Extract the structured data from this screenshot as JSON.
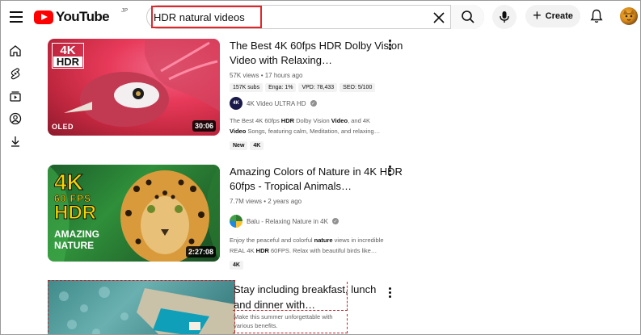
{
  "header": {
    "logo_text": "YouTube",
    "logo_country": "JP",
    "search_value": "HDR natural videos",
    "create_label": "Create"
  },
  "sidebar": {
    "items": [
      {
        "icon": "home-icon"
      },
      {
        "icon": "shorts-icon"
      },
      {
        "icon": "subscriptions-icon"
      },
      {
        "icon": "you-icon"
      },
      {
        "icon": "downloads-icon"
      }
    ]
  },
  "results": [
    {
      "thumb_badge_top": "4K",
      "thumb_badge_bottom": "HDR",
      "thumb_corner": "OLED",
      "duration": "30:06",
      "title": "The Best 4K 60fps HDR Dolby Vision Video with Relaxing…",
      "views": "57K views",
      "age": "17 hours ago",
      "chips": [
        "157K subs",
        "Enga: 1%",
        "VPD: 78,433",
        "SEO: 5/100"
      ],
      "channel": "4K Video ULTRA HD",
      "desc_line1_a": "The Best 4K 60fps ",
      "desc_line1_b": "HDR",
      "desc_line1_c": " Dolby Vision ",
      "desc_line1_d": "Video",
      "desc_line1_e": ", and 4K",
      "desc_line2_a": "Video",
      "desc_line2_b": " Songs, featuring calm, Meditation, and relaxing…",
      "tags": [
        "New",
        "4K"
      ]
    },
    {
      "thumb_line1": "4K",
      "thumb_line2": "60 FPS",
      "thumb_line3": "HDR",
      "thumb_line4": "AMAZING",
      "thumb_line5": "NATURE",
      "duration": "2:27:08",
      "title": "Amazing Colors of Nature in 4K HDR 60fps - Tropical Animals…",
      "views": "7.7M views",
      "age": "2 years ago",
      "channel": "Balu - Relaxing Nature in 4K",
      "desc_line1_a": "Enjoy the peaceful and colorful ",
      "desc_line1_b": "nature",
      "desc_line1_c": " views in incredible",
      "desc_line2_a": "REAL 4K ",
      "desc_line2_b": "HDR",
      "desc_line2_c": " 60FPS. Relax with beautiful birds like…",
      "tags": [
        "4K"
      ]
    },
    {
      "title": "Stay including breakfast, lunch and dinner with…",
      "desc_line1": "Make this summer unforgettable with",
      "desc_line2": "various benefits."
    }
  ]
}
